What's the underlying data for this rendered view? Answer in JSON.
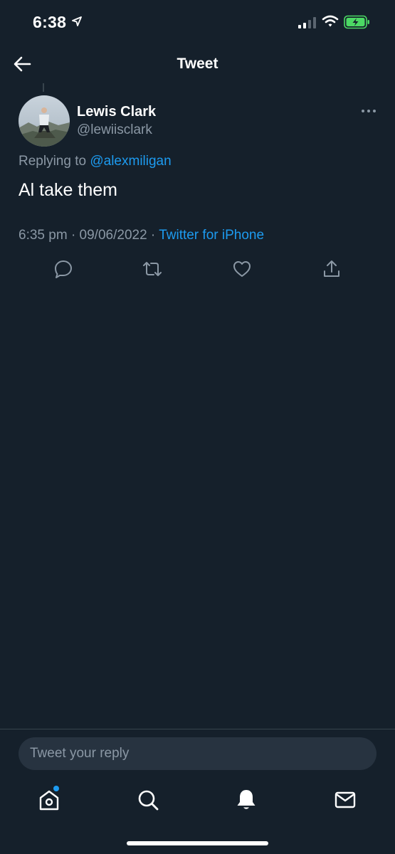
{
  "status_bar": {
    "time": "6:38",
    "location_icon": "location-arrow-icon",
    "signal_icon": "cellular-signal-icon",
    "wifi_icon": "wifi-icon",
    "battery_icon": "battery-charging-icon"
  },
  "header": {
    "back_icon": "arrow-left-icon",
    "title": "Tweet"
  },
  "tweet": {
    "author_name": "Lewis Clark",
    "author_handle": "@lewiisclark",
    "more_icon": "more-horizontal-icon",
    "replying_prefix": "Replying to",
    "replying_to": "@alexmiligan",
    "text": "Al take them",
    "time": "6:35 pm",
    "date": "09/06/2022",
    "separator": "·",
    "source": "Twitter for iPhone",
    "actions": [
      {
        "name": "reply",
        "icon": "reply-icon"
      },
      {
        "name": "retweet",
        "icon": "retweet-icon"
      },
      {
        "name": "like",
        "icon": "heart-icon"
      },
      {
        "name": "share",
        "icon": "share-icon"
      }
    ]
  },
  "composer": {
    "placeholder": "Tweet your reply"
  },
  "tab_bar": [
    {
      "name": "home",
      "icon": "home-icon",
      "has_notification_dot": true
    },
    {
      "name": "search",
      "icon": "search-icon"
    },
    {
      "name": "notifications",
      "icon": "bell-icon",
      "active": true
    },
    {
      "name": "messages",
      "icon": "mail-icon"
    }
  ],
  "colors": {
    "background": "#15202b",
    "accent": "#1d9bf0",
    "secondary_text": "#8b98a5",
    "input_background": "#273340",
    "battery_green": "#4cd964"
  }
}
